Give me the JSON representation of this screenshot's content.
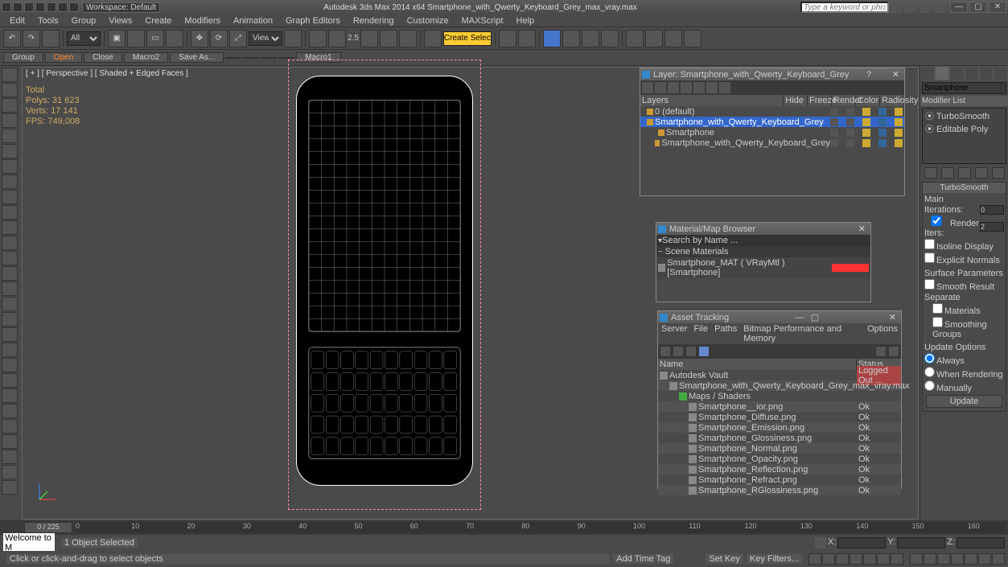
{
  "titlebar": {
    "workspace_label": "Workspace: Default",
    "app_title": "Autodesk 3ds Max  2014 x64     Smartphone_with_Qwerty_Keyboard_Grey_max_vray.max",
    "search_placeholder": "Type a keyword or phrase"
  },
  "menus": [
    "Edit",
    "Tools",
    "Group",
    "Views",
    "Create",
    "Modifiers",
    "Animation",
    "Graph Editors",
    "Rendering",
    "Customize",
    "MAXScript",
    "Help"
  ],
  "toolbar": {
    "filter": "All",
    "view": "View",
    "coord": "2.5",
    "selset": "Create Selection Se"
  },
  "toolbar2": {
    "items": [
      "Group",
      "Open",
      "Close",
      "Macro2",
      "Save As...",
      "",
      "",
      "",
      "",
      "Macro1"
    ]
  },
  "viewport": {
    "label": "[ + ] [ Perspective ] [ Shaded + Edged Faces ]",
    "stats": [
      "           Total",
      "Polys:   31 623",
      "Verts:   17 141",
      "",
      "FPS:    749,008"
    ]
  },
  "cmd_panel": {
    "obj_name": "Smartphone",
    "modlist_label": "Modifier List",
    "modifiers": [
      "TurboSmooth",
      "Editable Poly"
    ],
    "turbosmooth": {
      "title": "TurboSmooth",
      "main": "Main",
      "iterations_label": "Iterations:",
      "iterations": "0",
      "render_iters_label": "Render Iters:",
      "render_iters": "2",
      "isoline": "Isoline Display",
      "explicit": "Explicit Normals",
      "surface": "Surface Parameters",
      "smooth": "Smooth Result",
      "separate": "Separate",
      "materials": "Materials",
      "smoothing_groups": "Smoothing Groups",
      "update": "Update Options",
      "always": "Always",
      "whenrender": "When Rendering",
      "manually": "Manually",
      "update_btn": "Update"
    }
  },
  "layer_panel": {
    "title": "Layer: Smartphone_with_Qwerty_Keyboard_Grey",
    "columns": [
      "Layers",
      "Hide",
      "Freeze",
      "Render",
      "Color",
      "Radiosity"
    ],
    "rows": [
      {
        "name": "0 (default)",
        "indent": 0,
        "sel": false
      },
      {
        "name": "Smartphone_with_Qwerty_Keyboard_Grey",
        "indent": 0,
        "sel": true
      },
      {
        "name": "Smartphone",
        "indent": 1,
        "sel": false
      },
      {
        "name": "Smartphone_with_Qwerty_Keyboard_Grey",
        "indent": 1,
        "sel": false
      }
    ]
  },
  "matbrowser": {
    "title": "Material/Map Browser",
    "search": "Search by Name ...",
    "group": "Scene Materials",
    "item": "Smartphone_MAT ( VRayMtl )  [Smartphone]"
  },
  "asset_panel": {
    "title": "Asset Tracking",
    "menus": [
      "Server",
      "File",
      "Paths",
      "Bitmap Performance and Memory",
      "Options"
    ],
    "col_name": "Name",
    "col_status": "Status",
    "rows": [
      {
        "name": "Autodesk Vault",
        "status": "Logged Out ...",
        "indent": 0,
        "hl": true
      },
      {
        "name": "Smartphone_with_Qwerty_Keyboard_Grey_max_vray.max",
        "status": "",
        "indent": 1,
        "hl": true
      },
      {
        "name": "Maps / Shaders",
        "status": "",
        "indent": 2,
        "hl": true,
        "green": true
      },
      {
        "name": "Smartphone__ior.png",
        "status": "Ok",
        "indent": 3
      },
      {
        "name": "Smartphone_Diffuse.png",
        "status": "Ok",
        "indent": 3
      },
      {
        "name": "Smartphone_Emission.png",
        "status": "Ok",
        "indent": 3
      },
      {
        "name": "Smartphone_Glossiness.png",
        "status": "Ok",
        "indent": 3
      },
      {
        "name": "Smartphone_Normal.png",
        "status": "Ok",
        "indent": 3
      },
      {
        "name": "Smartphone_Opacity.png",
        "status": "Ok",
        "indent": 3
      },
      {
        "name": "Smartphone_Reflection.png",
        "status": "Ok",
        "indent": 3
      },
      {
        "name": "Smartphone_Refract.png",
        "status": "Ok",
        "indent": 3
      },
      {
        "name": "Smartphone_RGlossiness.png",
        "status": "Ok",
        "indent": 3
      }
    ]
  },
  "timeline": {
    "slider": "0 / 225",
    "ticks": [
      "0",
      "10",
      "20",
      "30",
      "40",
      "50",
      "60",
      "70",
      "80",
      "90",
      "100",
      "110",
      "120",
      "130",
      "140",
      "150",
      "160"
    ]
  },
  "statusbar": {
    "maxscript": "Welcome to M",
    "selected": "1 Object Selected",
    "x": "X:",
    "y": "Y:",
    "z": "Z:"
  },
  "bottombar": {
    "prompt": "Click or click-and-drag to select objects",
    "addtime": "Add Time Tag",
    "setkey": "Set Key",
    "keyfilters": "Key Filters..."
  }
}
